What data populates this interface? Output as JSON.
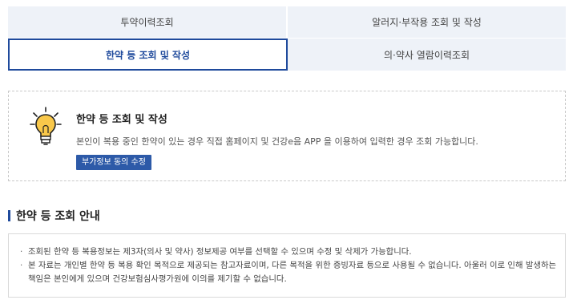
{
  "tabs": {
    "history": "투약이력조회",
    "allergy": "알러지·부작용 조회 및 작성",
    "herbal": "한약 등 조회 및 작성",
    "doctor": "의·약사 열람이력조회"
  },
  "infobox": {
    "title": "한약 등 조회 및 작성",
    "description": "본인이 복용 중인 한약이 있는 경우 직접 홈페이지 및 건강e음 APP 을 이용하여 입력한 경우 조회 가능합니다.",
    "button_label": "부가정보 동의 수정",
    "icon": "lightbulb-icon"
  },
  "section": {
    "title": "한약 등 조회 안내"
  },
  "notice": {
    "items": [
      "조회된 한약 등 복용정보는 제3자(의사 및 약사) 정보제공 여부를 선택할 수 있으며 수정 및 삭제가 가능합니다.",
      "본 자료는 개인별 한약 등 복용 확인 목적으로 제공되는 참고자료이며, 다른 목적을 위한 증빙자료 등으로 사용될 수 없습니다. 아울러 이로 인해 발생하는",
      "책임은 본인에게 있으며 건강보험심사평가원에 이의를 제기할 수 없습니다."
    ]
  },
  "colors": {
    "accent": "#1f4a9c",
    "button": "#2d5aa8",
    "tab_bg": "#eef2f8"
  }
}
